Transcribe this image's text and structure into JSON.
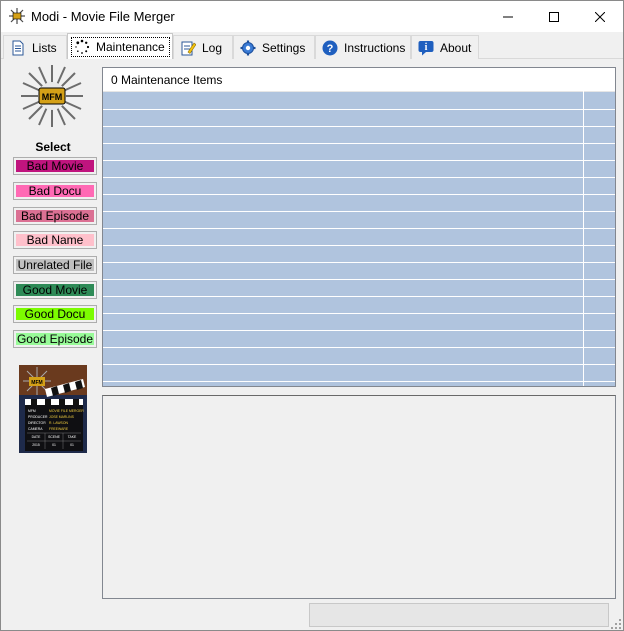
{
  "window": {
    "title": "Modi - Movie File Merger",
    "controls": {
      "minimize_icon": "minimize-icon",
      "maximize_icon": "maximize-icon",
      "close_icon": "close-icon"
    }
  },
  "tabs": [
    {
      "label": "Lists",
      "icon": "list-document-icon",
      "active": false
    },
    {
      "label": "Maintenance",
      "icon": "spinner-dots-icon",
      "active": true
    },
    {
      "label": "Log",
      "icon": "notepad-pencil-icon",
      "active": false
    },
    {
      "label": "Settings",
      "icon": "gear-icon",
      "active": false
    },
    {
      "label": "Instructions",
      "icon": "question-icon",
      "active": false
    },
    {
      "label": "About",
      "icon": "info-icon",
      "active": false
    }
  ],
  "sidebar": {
    "logo_text": "MFM",
    "select_label": "Select",
    "buttons": [
      {
        "label": "Bad Movie",
        "color": "#c0147e",
        "text_color": "#000000"
      },
      {
        "label": "Bad Docu",
        "color": "#ff69b4",
        "text_color": "#000000"
      },
      {
        "label": "Bad Episode",
        "color": "#db7093",
        "text_color": "#000000"
      },
      {
        "label": "Bad Name",
        "color": "#ffc0cb",
        "text_color": "#000000"
      },
      {
        "label": "Unrelated File",
        "color": "#c0c0c0",
        "text_color": "#000000"
      },
      {
        "label": "Good Movie",
        "color": "#2e8b57",
        "text_color": "#000000"
      },
      {
        "label": "Good Docu",
        "color": "#7cfc00",
        "text_color": "#000000"
      },
      {
        "label": "Good Episode",
        "color": "#98fb98",
        "text_color": "#000000"
      }
    ],
    "poster": {
      "logo_text": "MFM",
      "rows": [
        [
          "MFM",
          "MOVIE FILE MERGER"
        ],
        [
          "PRODUCER",
          "JOSE MARLINS"
        ],
        [
          "DIRECTOR",
          "R. LAWSON"
        ],
        [
          "CAMERA",
          "FREEWARE"
        ]
      ],
      "footer": [
        "DATE",
        "SCENE",
        "TAKE"
      ],
      "footer_values": [
        "2015",
        "01",
        "01"
      ]
    }
  },
  "main": {
    "grid_header": "0 Maintenance Items",
    "grid_bg": "#b0c4de"
  },
  "statusbar": {
    "text": ""
  }
}
